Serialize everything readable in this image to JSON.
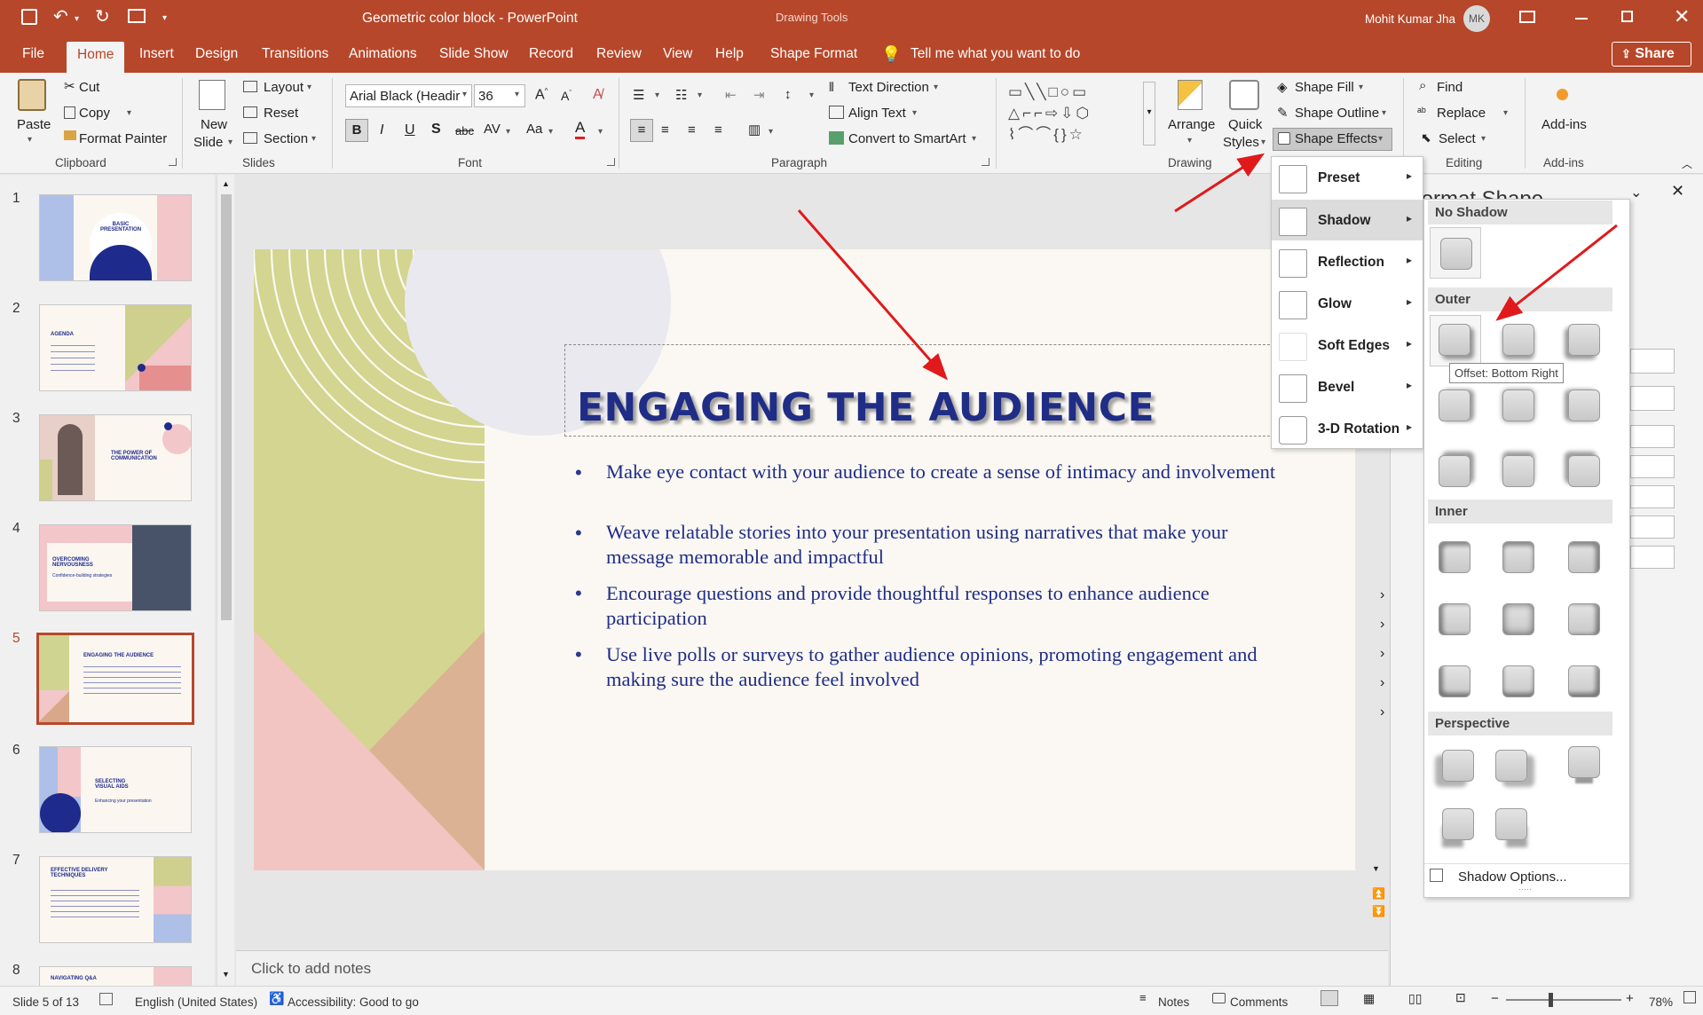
{
  "titlebar": {
    "document_title": "Geometric color block",
    "separator": " - ",
    "app_name": "PowerPoint",
    "context_tools": "Drawing Tools",
    "user_name": "Mohit Kumar Jha",
    "user_initials": "MK"
  },
  "tabs": [
    "File",
    "Home",
    "Insert",
    "Design",
    "Transitions",
    "Animations",
    "Slide Show",
    "Record",
    "Review",
    "View",
    "Help",
    "Shape Format"
  ],
  "tell_me": "Tell me what you want to do",
  "share_label": "Share",
  "ribbon": {
    "clipboard": {
      "paste": "Paste",
      "cut": "Cut",
      "copy": "Copy",
      "format_painter": "Format Painter",
      "group": "Clipboard"
    },
    "slides": {
      "new_slide_1": "New",
      "new_slide_2": "Slide",
      "layout": "Layout",
      "reset": "Reset",
      "section": "Section",
      "group": "Slides"
    },
    "font": {
      "font_name": "Arial Black (Headir",
      "font_size": "36",
      "group": "Font"
    },
    "paragraph": {
      "text_direction": "Text Direction",
      "align_text": "Align Text",
      "smartart": "Convert to SmartArt",
      "group": "Paragraph"
    },
    "drawing": {
      "arrange": "Arrange",
      "quick_1": "Quick",
      "quick_2": "Styles",
      "shape_fill": "Shape Fill",
      "shape_outline": "Shape Outline",
      "shape_effects": "Shape Effects",
      "group": "Drawing"
    },
    "editing": {
      "find": "Find",
      "replace": "Replace",
      "select": "Select",
      "group": "Editing"
    },
    "addins": {
      "label": "Add-ins",
      "group": "Add-ins"
    }
  },
  "slides_panel": [
    {
      "num": "1",
      "title": "BASIC PRESENTATION"
    },
    {
      "num": "2",
      "title": "AGENDA"
    },
    {
      "num": "3",
      "title": "THE POWER OF COMMUNICATION"
    },
    {
      "num": "4",
      "title": "OVERCOMING NERVOUSNESS",
      "sub": "Confidence-building strategies"
    },
    {
      "num": "5",
      "title": "ENGAGING THE AUDIENCE"
    },
    {
      "num": "6",
      "title": "SELECTING VISUAL AIDS",
      "sub": "Enhancing your presentation"
    },
    {
      "num": "7",
      "title": "EFFECTIVE DELIVERY TECHNIQUES"
    },
    {
      "num": "8",
      "title": "NAVIGATING Q&A"
    }
  ],
  "slide": {
    "title": "ENGAGING THE AUDIENCE",
    "bullets": [
      "Make eye contact with your audience to create a sense of intimacy and involvement",
      "Weave relatable stories into your presentation using narratives that make your message memorable and impactful",
      "Encourage questions and provide thoughtful responses to enhance audience participation",
      "Use live polls or surveys to gather audience opinions, promoting engagement and making sure the audience feel involved"
    ]
  },
  "effects_menu": [
    "Preset",
    "Shadow",
    "Reflection",
    "Glow",
    "Soft Edges",
    "Bevel",
    "3-D Rotation"
  ],
  "shadow_gallery": {
    "no_shadow": "No Shadow",
    "outer": "Outer",
    "inner": "Inner",
    "perspective": "Perspective",
    "tooltip": "Offset: Bottom Right",
    "options": "Shadow Options..."
  },
  "format_pane_title": "Format Shape",
  "notes_placeholder": "Click to add notes",
  "statusbar": {
    "slide_info": "Slide 5 of 13",
    "language": "English (United States)",
    "accessibility": "Accessibility: Good to go",
    "notes": "Notes",
    "comments": "Comments",
    "zoom": "78%"
  },
  "colors": {
    "accent": "#b7472a",
    "slide_title": "#1f2d86",
    "arrow": "#e0191b"
  }
}
